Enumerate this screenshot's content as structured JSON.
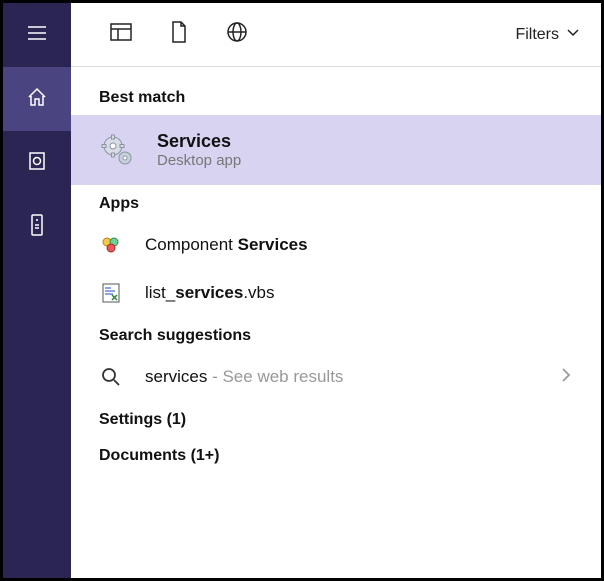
{
  "sidebar": {
    "items": [
      {
        "name": "menu",
        "icon": "hamburger"
      },
      {
        "name": "home",
        "icon": "home",
        "active": true
      },
      {
        "name": "recent",
        "icon": "recent-square"
      },
      {
        "name": "remote",
        "icon": "remote"
      }
    ]
  },
  "toolbar": {
    "icons": [
      {
        "name": "apps-tab",
        "icon": "apps"
      },
      {
        "name": "documents-tab",
        "icon": "document"
      },
      {
        "name": "web-tab",
        "icon": "globe"
      }
    ],
    "filters_label": "Filters"
  },
  "sections": {
    "best_match": {
      "header": "Best match",
      "item": {
        "title": "Services",
        "subtitle": "Desktop app",
        "icon": "gears"
      }
    },
    "apps": {
      "header": "Apps",
      "items": [
        {
          "prefix": "Component ",
          "bold": "Services",
          "suffix": "",
          "icon": "component-services"
        },
        {
          "prefix": "list_",
          "bold": "services",
          "suffix": ".vbs",
          "icon": "vbs-file"
        }
      ]
    },
    "suggestions": {
      "header": "Search suggestions",
      "item": {
        "query": "services",
        "hint": " - See web results",
        "icon": "search"
      }
    },
    "settings": {
      "header": "Settings (1)"
    },
    "documents": {
      "header": "Documents (1+)"
    }
  }
}
